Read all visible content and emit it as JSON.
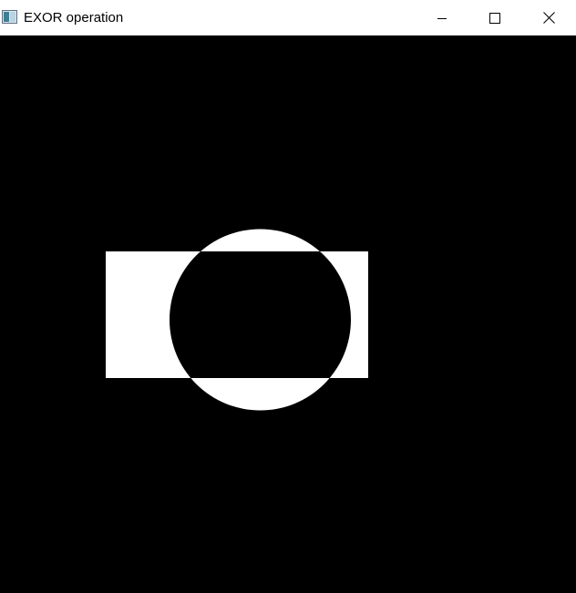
{
  "window": {
    "title": "EXOR operation",
    "app_icon": "image-window-icon",
    "controls": {
      "minimize_icon": "minimize-icon",
      "maximize_icon": "maximize-icon",
      "close_icon": "close-icon"
    }
  },
  "canvas": {
    "background_color": "#000000",
    "foreground_color": "#ffffff",
    "operation": "xor",
    "shapes": [
      "rectangle",
      "circle"
    ]
  }
}
